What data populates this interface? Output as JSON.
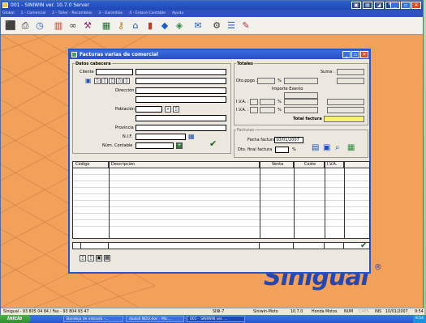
{
  "app": {
    "title": "001 - SINIWIN  ver. 10.7.0 Server",
    "menu": [
      "Global",
      "1 - Comercial",
      "2 - Taller - Recambios",
      "3 - Garantías",
      "4 - Enlace Contable",
      "Ayuda"
    ],
    "toolbar_icons": [
      "stamp-icon",
      "printer-icon",
      "clock-icon",
      "chart-icon",
      "binoculars-icon",
      "tools-icon",
      "calculator-icon",
      "key-icon",
      "warehouse-icon",
      "book-icon",
      "car-icon",
      "shield-icon",
      "message-icon",
      "bike-icon",
      "list-icon",
      "pencil-icon"
    ],
    "colors": {
      "desktop": "#f2a05a",
      "titlebar": "#2a55c9",
      "total_highlight": "#f4f07a"
    }
  },
  "brand": {
    "name": "Sinigual",
    "mark": "®"
  },
  "dialog": {
    "title": "Facturas varias de comercial",
    "datos_cabecera": {
      "section": "Datos cabecera",
      "cliente": "Cliente",
      "direccion": "Dirección",
      "poblacion": "Población",
      "provincia": "Provincia",
      "nif": "N.I.F.",
      "num_contable": "Núm. Contable"
    },
    "totales": {
      "section": "Totales",
      "suma": "Suma :",
      "dto_ppgo": "Dto.ppgo :",
      "pct": "%",
      "importe_exento": "Importe Exento",
      "iva1": "I.V.A. :",
      "iva2": "I.V.A. :",
      "total_factura": "Total factura :"
    },
    "facturas": {
      "section": "Facturas",
      "fecha_label": "Fecha factura",
      "fecha_value": "10/01/2007",
      "dto_final": "Dto. final factura",
      "pct": "%"
    },
    "grid": {
      "columns": [
        "Código",
        "Descripción",
        "Venta",
        "Coste",
        "I.V.A."
      ]
    }
  },
  "statusbar": {
    "phone": "Sinigual - 93 805 04 84 / Fax - 93 804 93 47",
    "terminal": "SINI-7",
    "product": "Siniwin-Moto",
    "version": "10.7.0",
    "company": "Honda Motos",
    "num": "NUM",
    "caps": "CAPS",
    "ins": "INS",
    "date": "10/01/2007",
    "time": "9:54"
  },
  "taskbar": {
    "start": "Inicio",
    "tasks": [
      "Bandeja de entrada -...",
      "doskill NOU.doc - Mic...",
      "001 - SINIWIN  ver. ..."
    ],
    "clock": "9:54"
  }
}
